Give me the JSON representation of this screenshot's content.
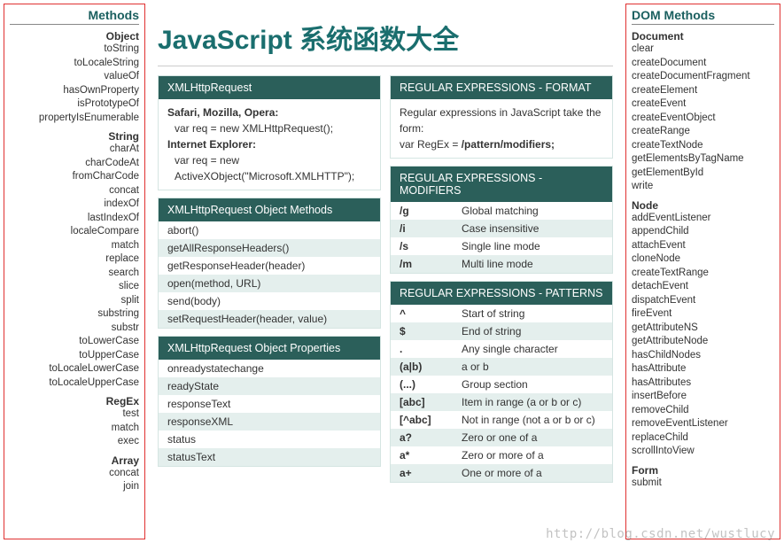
{
  "left": {
    "title": "Methods",
    "groups": [
      {
        "head": "Object",
        "items": [
          "toString",
          "toLocaleString",
          "valueOf",
          "hasOwnProperty",
          "isPrototypeOf",
          "propertyIsEnumerable"
        ]
      },
      {
        "head": "String",
        "items": [
          "charAt",
          "charCodeAt",
          "fromCharCode",
          "concat",
          "indexOf",
          "lastIndexOf",
          "localeCompare",
          "match",
          "replace",
          "search",
          "slice",
          "split",
          "substring",
          "substr",
          "toLowerCase",
          "toUpperCase",
          "toLocaleLowerCase",
          "toLocaleUpperCase"
        ]
      },
      {
        "head": "RegEx",
        "items": [
          "test",
          "match",
          "exec"
        ]
      },
      {
        "head": "Array",
        "items": [
          "concat",
          "join"
        ]
      }
    ]
  },
  "right": {
    "title": "DOM Methods",
    "groups": [
      {
        "head": "Document",
        "items": [
          "clear",
          "createDocument",
          "createDocumentFragment",
          "createElement",
          "createEvent",
          "createEventObject",
          "createRange",
          "createTextNode",
          "getElementsByTagName",
          "getElementById",
          "write"
        ]
      },
      {
        "head": "Node",
        "items": [
          "addEventListener",
          "appendChild",
          "attachEvent",
          "cloneNode",
          "createTextRange",
          "detachEvent",
          "dispatchEvent",
          "fireEvent",
          "getAttributeNS",
          "getAttributeNode",
          "hasChildNodes",
          "hasAttribute",
          "hasAttributes",
          "insertBefore",
          "removeChild",
          "removeEventListener",
          "replaceChild",
          "scrollIntoView"
        ]
      },
      {
        "head": "Form",
        "items": [
          "submit"
        ]
      }
    ]
  },
  "center": {
    "title": "JavaScript 系统函数大全",
    "xhr_card": {
      "head": "XMLHttpRequest",
      "b1_label": "Safari, Mozilla, Opera:",
      "b1_code": "var req = new XMLHttpRequest();",
      "b2_label": "Internet Explorer:",
      "b2_code1": "var req = new",
      "b2_code2": "ActiveXObject(\"Microsoft.XMLHTTP\");"
    },
    "xhr_methods": {
      "head": "XMLHttpRequest Object Methods",
      "rows": [
        "abort()",
        "getAllResponseHeaders()",
        "getResponseHeader(header)",
        "open(method, URL)",
        "send(body)",
        "setRequestHeader(header, value)"
      ]
    },
    "xhr_props": {
      "head": "XMLHttpRequest Object Properties",
      "rows": [
        "onreadystatechange",
        "readyState",
        "responseText",
        "responseXML",
        "status",
        "statusText"
      ]
    },
    "re_format": {
      "head": "REGULAR EXPRESSIONS - FORMAT",
      "line1": "Regular expressions in JavaScript take the form:",
      "line2_pre": "var RegEx = ",
      "line2_bold": "/pattern/modifiers;"
    },
    "re_mod": {
      "head": "REGULAR EXPRESSIONS - MODIFIERS",
      "rows": [
        {
          "k": "/g",
          "v": "Global matching"
        },
        {
          "k": "/i",
          "v": "Case insensitive"
        },
        {
          "k": "/s",
          "v": "Single line mode"
        },
        {
          "k": "/m",
          "v": "Multi line mode"
        }
      ]
    },
    "re_pat": {
      "head": "REGULAR EXPRESSIONS - PATTERNS",
      "rows": [
        {
          "k": "^",
          "v": "Start of string"
        },
        {
          "k": "$",
          "v": "End of string"
        },
        {
          "k": ".",
          "v": "Any single character"
        },
        {
          "k": "(a|b)",
          "v": "a or b"
        },
        {
          "k": "(...)",
          "v": "Group section"
        },
        {
          "k": "[abc]",
          "v": "Item in range (a or b or c)"
        },
        {
          "k": "[^abc]",
          "v": "Not in range (not a or b or c)"
        },
        {
          "k": "a?",
          "v": "Zero or one of a"
        },
        {
          "k": "a*",
          "v": "Zero or more of a"
        },
        {
          "k": "a+",
          "v": "One or more of a"
        }
      ]
    }
  },
  "watermark": "http://blog.csdn.net/wustlucy"
}
